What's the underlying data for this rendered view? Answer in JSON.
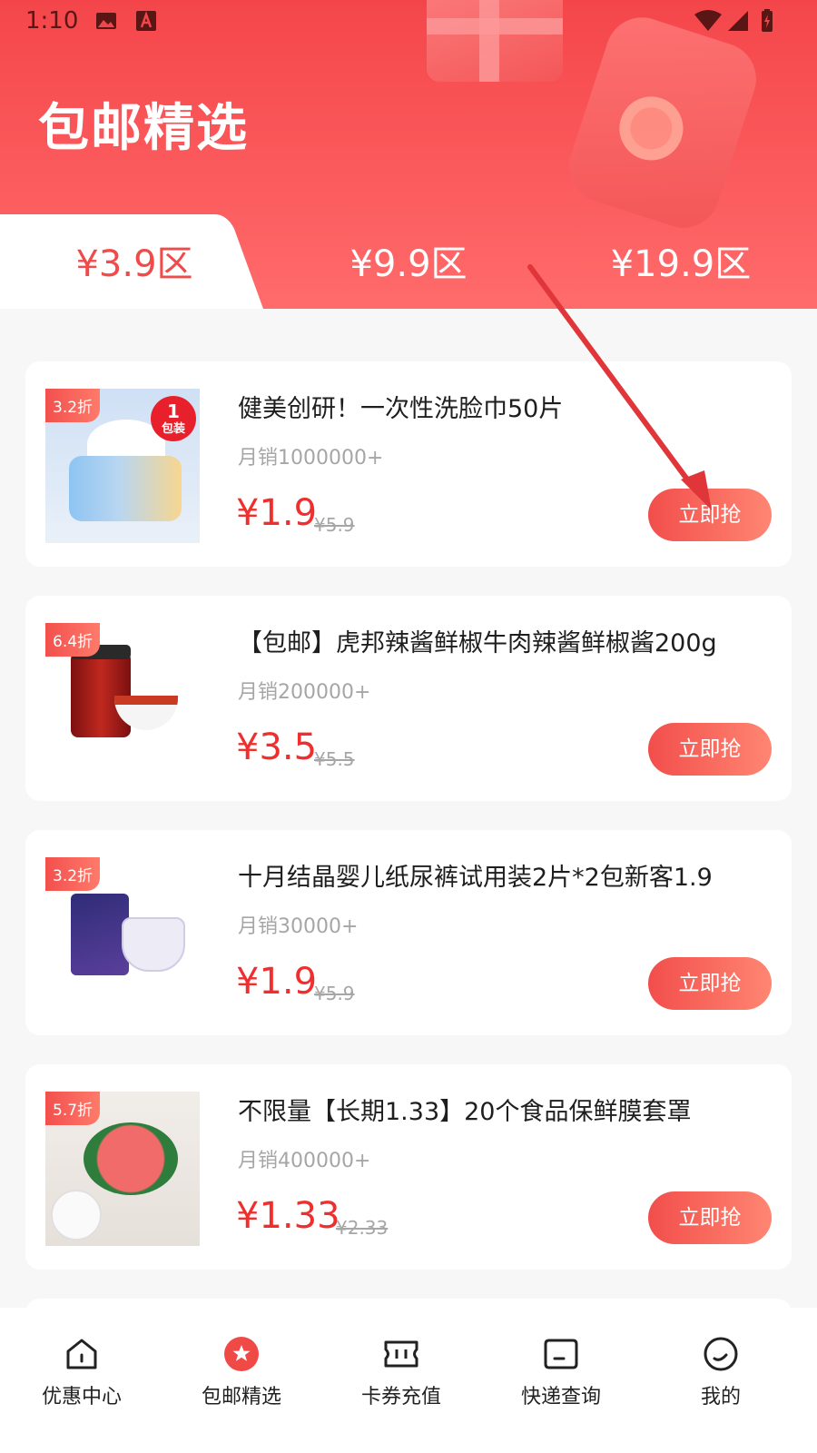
{
  "status_bar": {
    "time": "1:10"
  },
  "header": {
    "title": "包邮精选"
  },
  "tabs": [
    {
      "label": "¥3.9区",
      "active": true
    },
    {
      "label": "¥9.9区",
      "active": false
    },
    {
      "label": "¥19.9区",
      "active": false
    }
  ],
  "products": [
    {
      "badge": "3.2折",
      "name": "健美创研！一次性洗脸巾50片",
      "sales": "月销1000000+",
      "price": "¥1.9",
      "original_price": "¥5.9",
      "button": "立即抢",
      "pack_label_1": "1",
      "pack_label_2": "包装"
    },
    {
      "badge": "6.4折",
      "name": "【包邮】虎邦辣酱鲜椒牛肉辣酱鲜椒酱200g",
      "sales": "月销200000+",
      "price": "¥3.5",
      "original_price": "¥5.5",
      "button": "立即抢"
    },
    {
      "badge": "3.2折",
      "name": "十月结晶婴儿纸尿裤试用装2片*2包新客1.9",
      "sales": "月销30000+",
      "price": "¥1.9",
      "original_price": "¥5.9",
      "button": "立即抢"
    },
    {
      "badge": "5.7折",
      "name": "不限量【长期1.33】20个食品保鲜膜套罩",
      "sales": "月销400000+",
      "price": "¥1.33",
      "original_price": "¥2.33",
      "button": "立即抢"
    }
  ],
  "bottom_nav": [
    {
      "label": "优惠中心",
      "icon": "home-icon",
      "active": false
    },
    {
      "label": "包邮精选",
      "icon": "star-icon",
      "active": true
    },
    {
      "label": "卡券充值",
      "icon": "ticket-icon",
      "active": false
    },
    {
      "label": "快递查询",
      "icon": "package-icon",
      "active": false
    },
    {
      "label": "我的",
      "icon": "profile-icon",
      "active": false
    }
  ],
  "colors": {
    "primary": "#f4464a",
    "price": "#f02e2e"
  }
}
